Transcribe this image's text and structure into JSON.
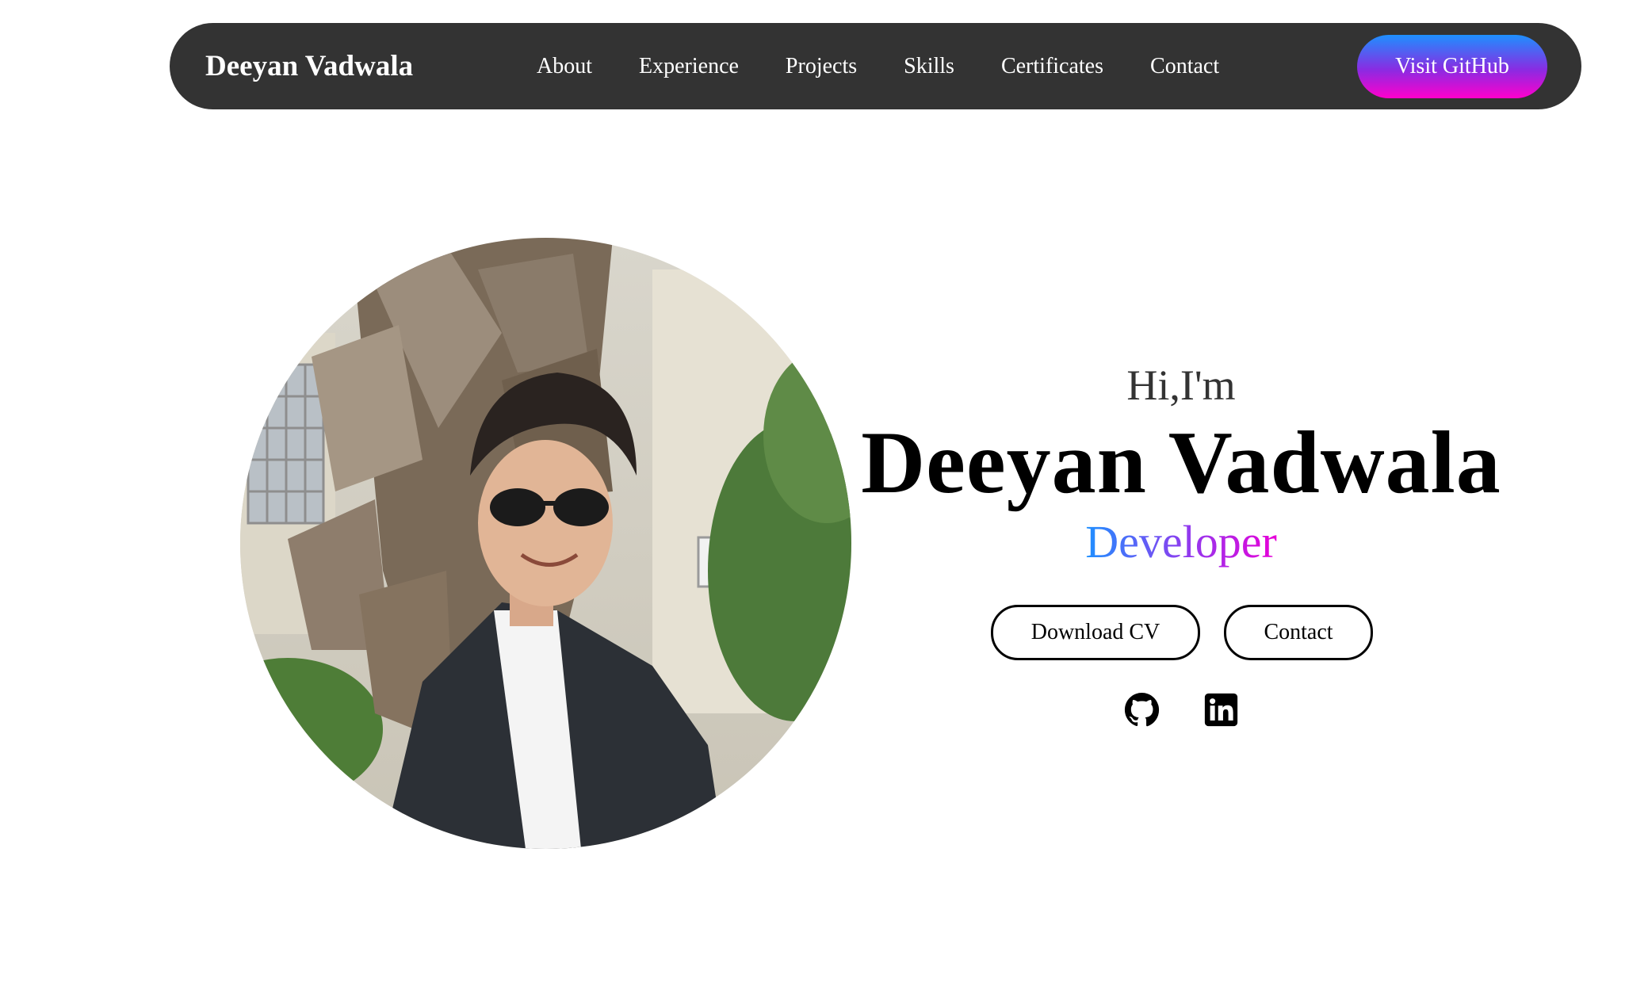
{
  "navbar": {
    "brand": "Deeyan Vadwala",
    "links": [
      {
        "label": "About"
      },
      {
        "label": "Experience"
      },
      {
        "label": "Projects"
      },
      {
        "label": "Skills"
      },
      {
        "label": "Certificates"
      },
      {
        "label": "Contact"
      }
    ],
    "cta_label": "Visit GitHub"
  },
  "hero": {
    "greeting": "Hi,I'm",
    "name": "Deeyan Vadwala",
    "role": "Developer",
    "buttons": {
      "download_cv": "Download CV",
      "contact": "Contact"
    },
    "socials": [
      {
        "icon": "github-icon"
      },
      {
        "icon": "linkedin-icon"
      }
    ]
  },
  "colors": {
    "navbar_bg": "#333333",
    "gradient_start": "#1e90ff",
    "gradient_mid": "#8a2be2",
    "gradient_end": "#ff00cc"
  }
}
